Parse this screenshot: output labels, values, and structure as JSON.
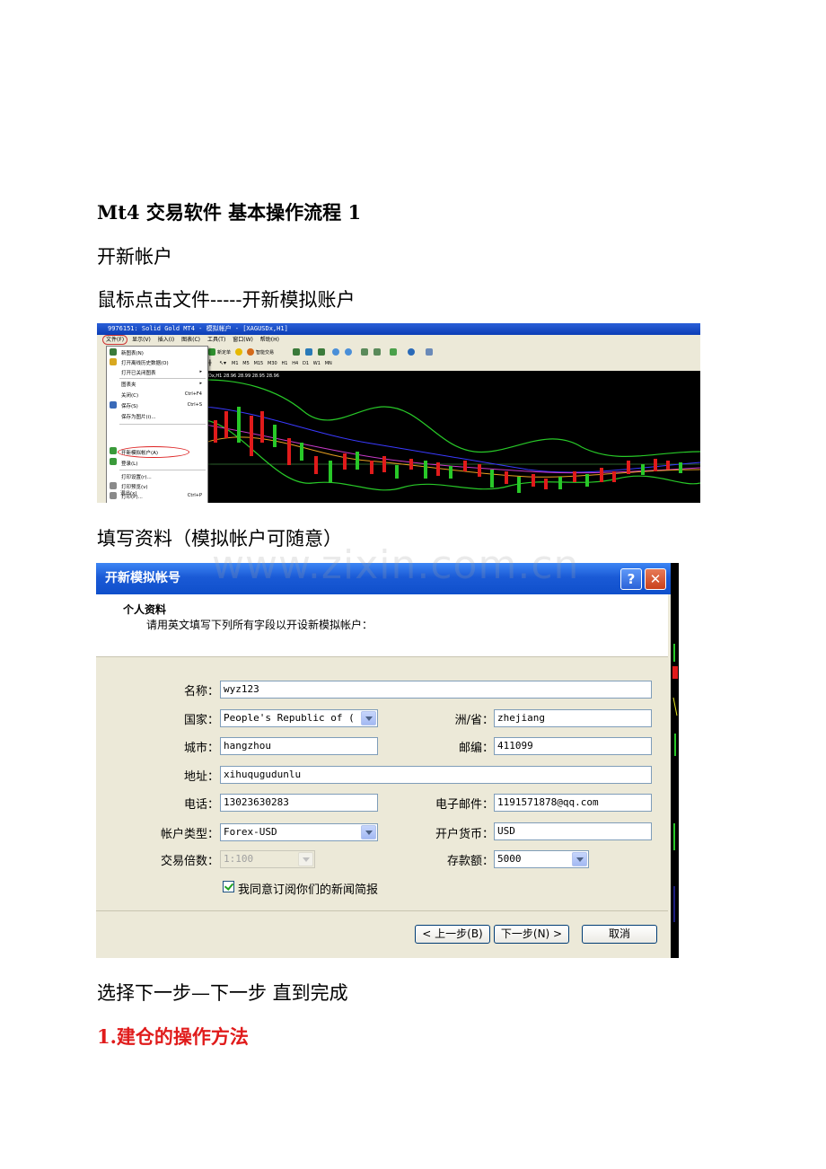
{
  "document": {
    "heading": "Mt4 交易软件  基本操作流程  1",
    "section_open_account": "开新帐户",
    "instruction_click_file": "鼠标点击文件-----开新模拟账户",
    "instruction_fill_info": "填写资料（模拟帐户可随意）",
    "instruction_next": "选择下一步—下一步  直到完成",
    "section_open_position": "1.建仓的操作方法",
    "watermark": "www.zixin.com.cn"
  },
  "mt4_window": {
    "title": "9976151: Solid Gold MT4 - 模拟帐户 - [XAGUSDx,H1]",
    "menu": [
      "文件(F)",
      "显示(V)",
      "插入(I)",
      "图表(C)",
      "工具(T)",
      "窗口(W)",
      "帮助(H)"
    ],
    "toolbar": {
      "new_order": "新定单",
      "expert": "智能交易"
    },
    "timeframes": [
      "M1",
      "M5",
      "M15",
      "M30",
      "H1",
      "H4",
      "D1",
      "W1",
      "MN"
    ],
    "chart_label": "Dx,H1 28.96 28.99 28.95 28.96",
    "file_menu": [
      {
        "label": "新图表(N)",
        "shortcut": ""
      },
      {
        "label": "打开离线历史数据(O)",
        "shortcut": ""
      },
      {
        "label": "打开已关闭图表",
        "shortcut": "▸"
      },
      {
        "label": "图表夹",
        "shortcut": "▸"
      },
      {
        "label": "关闭(C)",
        "shortcut": "Ctrl+F4"
      },
      {
        "label": "保存(S)",
        "shortcut": "Ctrl+S"
      },
      {
        "label": "保存为图片(i)...",
        "shortcut": ""
      },
      {
        "label": "开新模拟帐户(A)",
        "shortcut": ""
      },
      {
        "label": "登录(L)",
        "shortcut": ""
      },
      {
        "label": "打印设置(r)...",
        "shortcut": ""
      },
      {
        "label": "打印预览(v)",
        "shortcut": ""
      },
      {
        "label": "打印(P)...",
        "shortcut": "Ctrl+P"
      },
      {
        "label": "退出(x)",
        "shortcut": ""
      }
    ]
  },
  "dialog": {
    "title": "开新模拟帐号",
    "help_button": "?",
    "close_button": "✕",
    "header_title": "个人资料",
    "header_subtitle": "请用英文填写下列所有字段以开设新模拟帐户：",
    "labels": {
      "name": "名称：",
      "country": "国家：",
      "state": "洲/省：",
      "city": "城市：",
      "zip": "邮编：",
      "address": "地址：",
      "phone": "电话：",
      "email": "电子邮件：",
      "account_type": "帐户类型：",
      "currency": "开户货币：",
      "leverage": "交易倍数：",
      "deposit": "存款额："
    },
    "values": {
      "name": "wyz123",
      "country": "People's Republic of (",
      "state": "zhejiang",
      "city": "hangzhou",
      "zip": "411099",
      "address": "xihuqugudunlu",
      "phone": "13023630283",
      "email": "1191571878@qq.com",
      "account_type": "Forex-USD",
      "currency": "USD",
      "leverage": "1:100",
      "deposit": "5000"
    },
    "newsletter_label": "我同意订阅你们的新闻简报",
    "newsletter_checked": true,
    "buttons": {
      "back": "< 上一步(B)",
      "next": "下一步(N) >",
      "cancel": "取消"
    }
  },
  "colors": {
    "red_heading": "#e01b1b",
    "xp_title_blue": "#1a5ad6"
  }
}
